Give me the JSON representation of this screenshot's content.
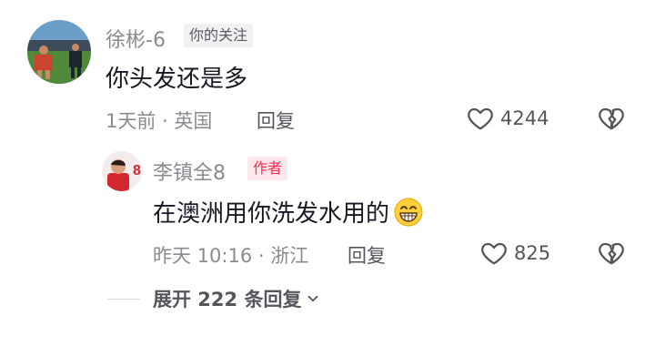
{
  "comment": {
    "author": "徐彬-6",
    "badge": "你的关注",
    "text": "你头发还是多",
    "time_location": "1天前 · 英国",
    "reply_label": "回复",
    "likes": "4244"
  },
  "reply": {
    "author": "李镇全8",
    "badge": "作者",
    "text": "在澳洲用你洗发水用的",
    "emoji": "grinning-face",
    "time_location": "昨天 10:16 · 浙江",
    "reply_label": "回复",
    "likes": "825"
  },
  "expand": {
    "label": "展开 222 条回复"
  },
  "icons": {
    "like": "heart-outline-icon",
    "dislike": "broken-heart-icon",
    "expand": "chevron-down-icon"
  },
  "colors": {
    "author_badge": "#fe2c55",
    "muted_text": "#8a8b91"
  }
}
